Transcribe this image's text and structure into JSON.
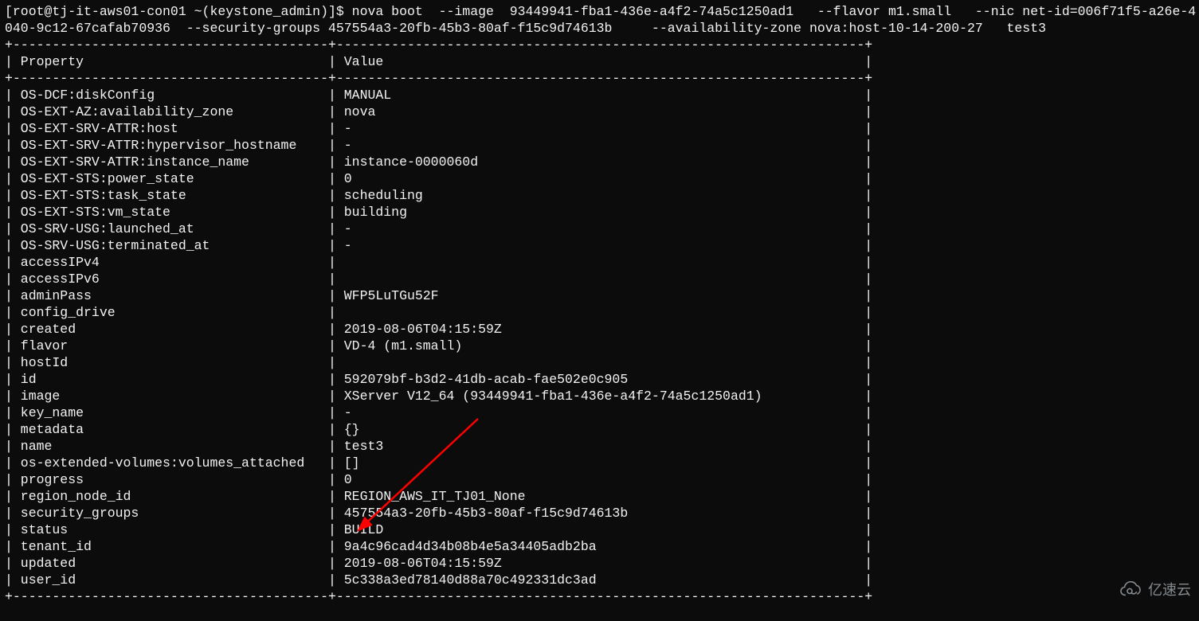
{
  "prompt": {
    "user": "root",
    "host": "tj-it-aws01-con01",
    "cwd": "~",
    "context": "(keystone_admin)",
    "command": "nova boot  --image  93449941-fba1-436e-a4f2-74a5c1250ad1   --flavor m1.small   --nic net-id=006f71f5-a26e-4040-9c12-67cafab70936  --security-groups 457554a3-20fb-45b3-80af-f15c9d74613b     --availability-zone nova:host-10-14-200-27   test3"
  },
  "table": {
    "col1_header": "Property",
    "col2_header": "Value",
    "col1_width": 38,
    "col2_width": 65,
    "rows": [
      {
        "property": "OS-DCF:diskConfig",
        "value": "MANUAL"
      },
      {
        "property": "OS-EXT-AZ:availability_zone",
        "value": "nova"
      },
      {
        "property": "OS-EXT-SRV-ATTR:host",
        "value": "-"
      },
      {
        "property": "OS-EXT-SRV-ATTR:hypervisor_hostname",
        "value": "-"
      },
      {
        "property": "OS-EXT-SRV-ATTR:instance_name",
        "value": "instance-0000060d"
      },
      {
        "property": "OS-EXT-STS:power_state",
        "value": "0"
      },
      {
        "property": "OS-EXT-STS:task_state",
        "value": "scheduling"
      },
      {
        "property": "OS-EXT-STS:vm_state",
        "value": "building"
      },
      {
        "property": "OS-SRV-USG:launched_at",
        "value": "-"
      },
      {
        "property": "OS-SRV-USG:terminated_at",
        "value": "-"
      },
      {
        "property": "accessIPv4",
        "value": ""
      },
      {
        "property": "accessIPv6",
        "value": ""
      },
      {
        "property": "adminPass",
        "value": "WFP5LuTGu52F"
      },
      {
        "property": "config_drive",
        "value": ""
      },
      {
        "property": "created",
        "value": "2019-08-06T04:15:59Z"
      },
      {
        "property": "flavor",
        "value": "VD-4 (m1.small)"
      },
      {
        "property": "hostId",
        "value": ""
      },
      {
        "property": "id",
        "value": "592079bf-b3d2-41db-acab-fae502e0c905"
      },
      {
        "property": "image",
        "value": "XServer V12_64 (93449941-fba1-436e-a4f2-74a5c1250ad1)"
      },
      {
        "property": "key_name",
        "value": "-"
      },
      {
        "property": "metadata",
        "value": "{}"
      },
      {
        "property": "name",
        "value": "test3"
      },
      {
        "property": "os-extended-volumes:volumes_attached",
        "value": "[]"
      },
      {
        "property": "progress",
        "value": "0"
      },
      {
        "property": "region_node_id",
        "value": "REGION_AWS_IT_TJ01_None"
      },
      {
        "property": "security_groups",
        "value": "457554a3-20fb-45b3-80af-f15c9d74613b"
      },
      {
        "property": "status",
        "value": "BUILD"
      },
      {
        "property": "tenant_id",
        "value": "9a4c96cad4d34b08b4e5a34405adb2ba"
      },
      {
        "property": "updated",
        "value": "2019-08-06T04:15:59Z"
      },
      {
        "property": "user_id",
        "value": "5c338a3ed78140d88a70c492331dc3ad"
      }
    ]
  },
  "watermark": "亿速云",
  "annotation": {
    "arrow_color": "#ff0000",
    "arrow_target_row": "status"
  }
}
